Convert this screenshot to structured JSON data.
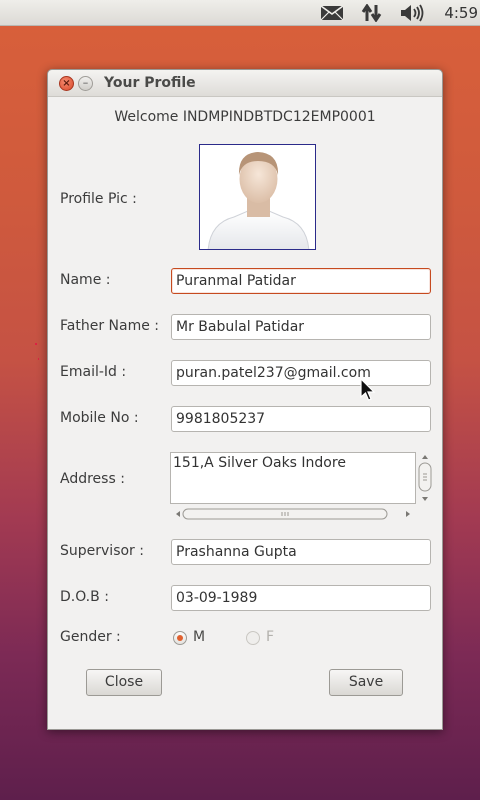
{
  "status_bar": {
    "time": "4:59",
    "icons": [
      "mail-icon",
      "network-transfer-icon",
      "volume-icon"
    ]
  },
  "window": {
    "title": "Your Profile",
    "close_glyph": "×",
    "minimize_glyph": "–"
  },
  "welcome": "Welcome INDMPINDBTDC12EMP0001",
  "form": {
    "profile_pic_label": "Profile Pic :",
    "name_label": "Name :",
    "name_value": "Puranmal Patidar",
    "father_label": "Father Name :",
    "father_value": "Mr Babulal Patidar",
    "email_label": "Email-Id :",
    "email_value": "puran.patel237@gmail.com",
    "mobile_label": "Mobile No :",
    "mobile_value": "9981805237",
    "address_label": "Address :",
    "address_value": "151,A Silver Oaks Indore",
    "supervisor_label": "Supervisor :",
    "supervisor_value": "Prashanna Gupta",
    "dob_label": "D.O.B :",
    "dob_value": "03-09-1989",
    "gender_label": "Gender :",
    "gender_options": [
      "M",
      "F"
    ],
    "gender_selected": "M"
  },
  "buttons": {
    "close": "Close",
    "save": "Save"
  },
  "colors": {
    "accent": "#e0602f",
    "focus_border": "#c64a1f",
    "photo_border": "#2b2b8a"
  }
}
